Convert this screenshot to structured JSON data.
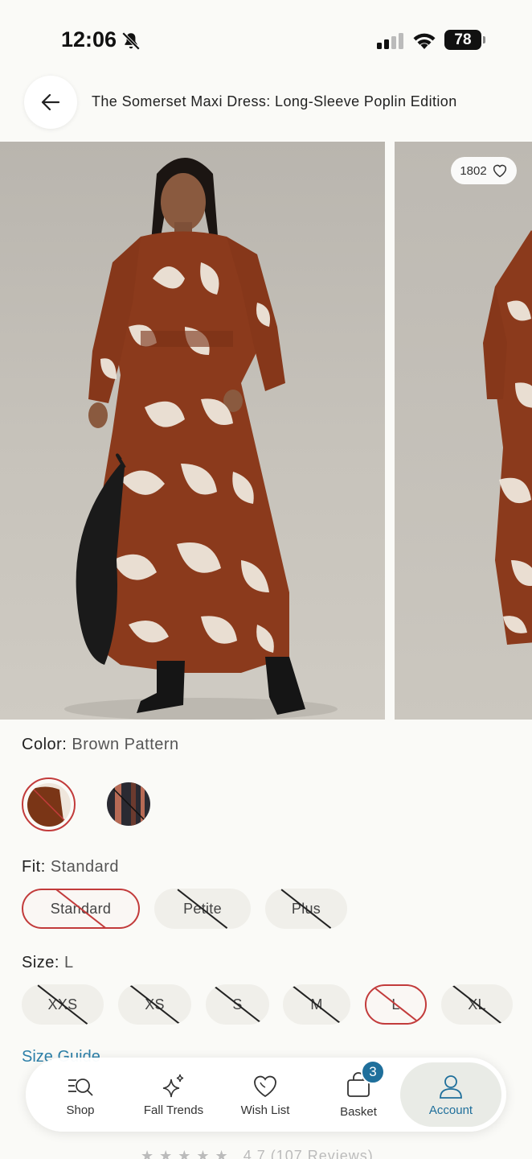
{
  "status_bar": {
    "time": "12:06",
    "battery": "78",
    "icons": [
      "bell-slash-icon",
      "cellular-signal-icon",
      "wifi-icon",
      "battery-icon"
    ]
  },
  "header": {
    "title": "The Somerset Maxi Dress: Long-Sleeve Poplin Edition",
    "back_icon": "arrow-left-icon"
  },
  "gallery": {
    "like_count": "1802",
    "like_icon": "heart-outline-icon"
  },
  "color": {
    "label": "Color:",
    "value": "Brown Pattern",
    "swatches": [
      {
        "name": "brown-pattern",
        "selected": true,
        "available": false,
        "colors": [
          "#7a3516",
          "#efe6dc"
        ]
      },
      {
        "name": "dark-pattern",
        "selected": false,
        "available": false,
        "colors": [
          "#2a2a32",
          "#b76a55"
        ]
      }
    ]
  },
  "fit": {
    "label": "Fit:",
    "value": "Standard",
    "options": [
      {
        "label": "Standard",
        "selected": true
      },
      {
        "label": "Petite",
        "selected": false
      },
      {
        "label": "Plus",
        "selected": false
      }
    ]
  },
  "size": {
    "label": "Size:",
    "value": "L",
    "options": [
      {
        "label": "XXS",
        "selected": false
      },
      {
        "label": "XS",
        "selected": false
      },
      {
        "label": "S",
        "selected": false
      },
      {
        "label": "M",
        "selected": false
      },
      {
        "label": "L",
        "selected": true
      },
      {
        "label": "XL",
        "selected": false
      }
    ]
  },
  "size_guide": "Size Guide",
  "reviews_peek": "4.7 (107 Reviews)",
  "bottom_nav": {
    "items": [
      {
        "label": "Shop",
        "icon": "search-list-icon"
      },
      {
        "label": "Fall Trends",
        "icon": "sparkles-icon"
      },
      {
        "label": "Wish List",
        "icon": "heart-icon"
      },
      {
        "label": "Basket",
        "icon": "shopping-bag-icon",
        "badge": "3"
      },
      {
        "label": "Account",
        "icon": "person-icon",
        "active": true
      }
    ]
  },
  "colors": {
    "accent_blue": "#1f6f9b",
    "selected_red": "#c23b3b",
    "background": "#fafaf7"
  }
}
